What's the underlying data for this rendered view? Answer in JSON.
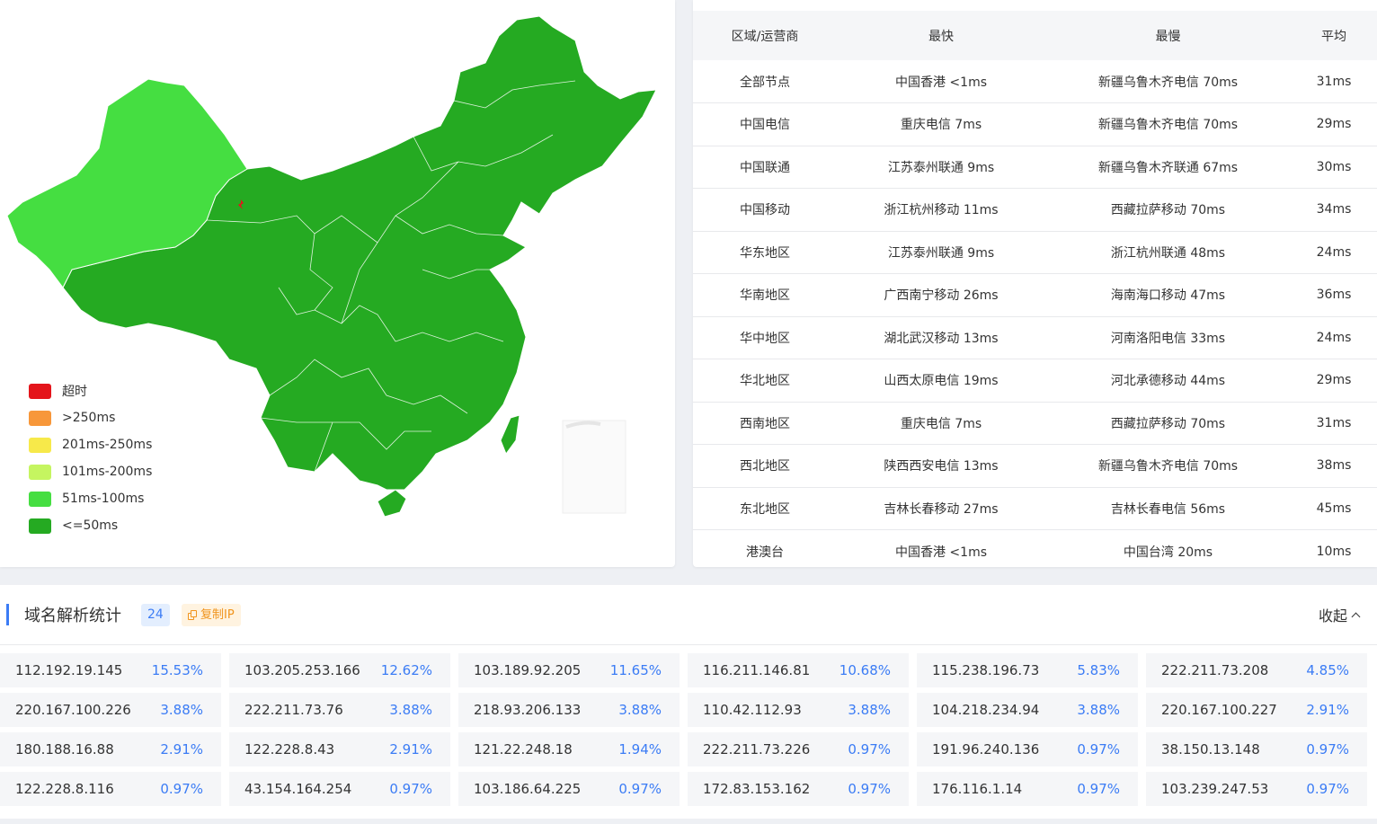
{
  "colors": {
    "timeout": "#e4151b",
    "over250": "#f7973a",
    "ms201_250": "#f7e94a",
    "ms101_200": "#c5f560",
    "ms51_100": "#45de41",
    "le50": "#25aa22",
    "accent": "#3b7cf5"
  },
  "map": {
    "legend": [
      {
        "label": "超时",
        "color": "#e4151b"
      },
      {
        "label": ">250ms",
        "color": "#f7973a"
      },
      {
        "label": "201ms-250ms",
        "color": "#f7e94a"
      },
      {
        "label": "101ms-200ms",
        "color": "#c5f560"
      },
      {
        "label": "51ms-100ms",
        "color": "#45de41"
      },
      {
        "label": "<=50ms",
        "color": "#25aa22"
      }
    ]
  },
  "speed_table": {
    "headers": [
      "区域/运营商",
      "最快",
      "最慢",
      "平均"
    ],
    "rows": [
      [
        "全部节点",
        "中国香港 <1ms",
        "新疆乌鲁木齐电信 70ms",
        "31ms"
      ],
      [
        "中国电信",
        "重庆电信 7ms",
        "新疆乌鲁木齐电信 70ms",
        "29ms"
      ],
      [
        "中国联通",
        "江苏泰州联通 9ms",
        "新疆乌鲁木齐联通 67ms",
        "30ms"
      ],
      [
        "中国移动",
        "浙江杭州移动 11ms",
        "西藏拉萨移动 70ms",
        "34ms"
      ],
      [
        "华东地区",
        "江苏泰州联通 9ms",
        "浙江杭州联通 48ms",
        "24ms"
      ],
      [
        "华南地区",
        "广西南宁移动 26ms",
        "海南海口移动 47ms",
        "36ms"
      ],
      [
        "华中地区",
        "湖北武汉移动 13ms",
        "河南洛阳电信 33ms",
        "24ms"
      ],
      [
        "华北地区",
        "山西太原电信 19ms",
        "河北承德移动 44ms",
        "29ms"
      ],
      [
        "西南地区",
        "重庆电信 7ms",
        "西藏拉萨移动 70ms",
        "31ms"
      ],
      [
        "西北地区",
        "陕西西安电信 13ms",
        "新疆乌鲁木齐电信 70ms",
        "38ms"
      ],
      [
        "东北地区",
        "吉林长春移动 27ms",
        "吉林长春电信 56ms",
        "45ms"
      ],
      [
        "港澳台",
        "中国香港 <1ms",
        "中国台湾 20ms",
        "10ms"
      ]
    ]
  },
  "dns": {
    "title": "域名解析统计",
    "count": "24",
    "copy_label": "复制IP",
    "collapse_label": "收起",
    "ips": [
      {
        "ip": "112.192.19.145",
        "pct": "15.53%"
      },
      {
        "ip": "103.205.253.166",
        "pct": "12.62%"
      },
      {
        "ip": "103.189.92.205",
        "pct": "11.65%"
      },
      {
        "ip": "116.211.146.81",
        "pct": "10.68%"
      },
      {
        "ip": "115.238.196.73",
        "pct": "5.83%"
      },
      {
        "ip": "222.211.73.208",
        "pct": "4.85%"
      },
      {
        "ip": "220.167.100.226",
        "pct": "3.88%"
      },
      {
        "ip": "222.211.73.76",
        "pct": "3.88%"
      },
      {
        "ip": "218.93.206.133",
        "pct": "3.88%"
      },
      {
        "ip": "110.42.112.93",
        "pct": "3.88%"
      },
      {
        "ip": "104.218.234.94",
        "pct": "3.88%"
      },
      {
        "ip": "220.167.100.227",
        "pct": "2.91%"
      },
      {
        "ip": "180.188.16.88",
        "pct": "2.91%"
      },
      {
        "ip": "122.228.8.43",
        "pct": "2.91%"
      },
      {
        "ip": "121.22.248.18",
        "pct": "1.94%"
      },
      {
        "ip": "222.211.73.226",
        "pct": "0.97%"
      },
      {
        "ip": "191.96.240.136",
        "pct": "0.97%"
      },
      {
        "ip": "38.150.13.148",
        "pct": "0.97%"
      },
      {
        "ip": "122.228.8.116",
        "pct": "0.97%"
      },
      {
        "ip": "43.154.164.254",
        "pct": "0.97%"
      },
      {
        "ip": "103.186.64.225",
        "pct": "0.97%"
      },
      {
        "ip": "172.83.153.162",
        "pct": "0.97%"
      },
      {
        "ip": "176.116.1.14",
        "pct": "0.97%"
      },
      {
        "ip": "103.239.247.53",
        "pct": "0.97%"
      }
    ]
  }
}
